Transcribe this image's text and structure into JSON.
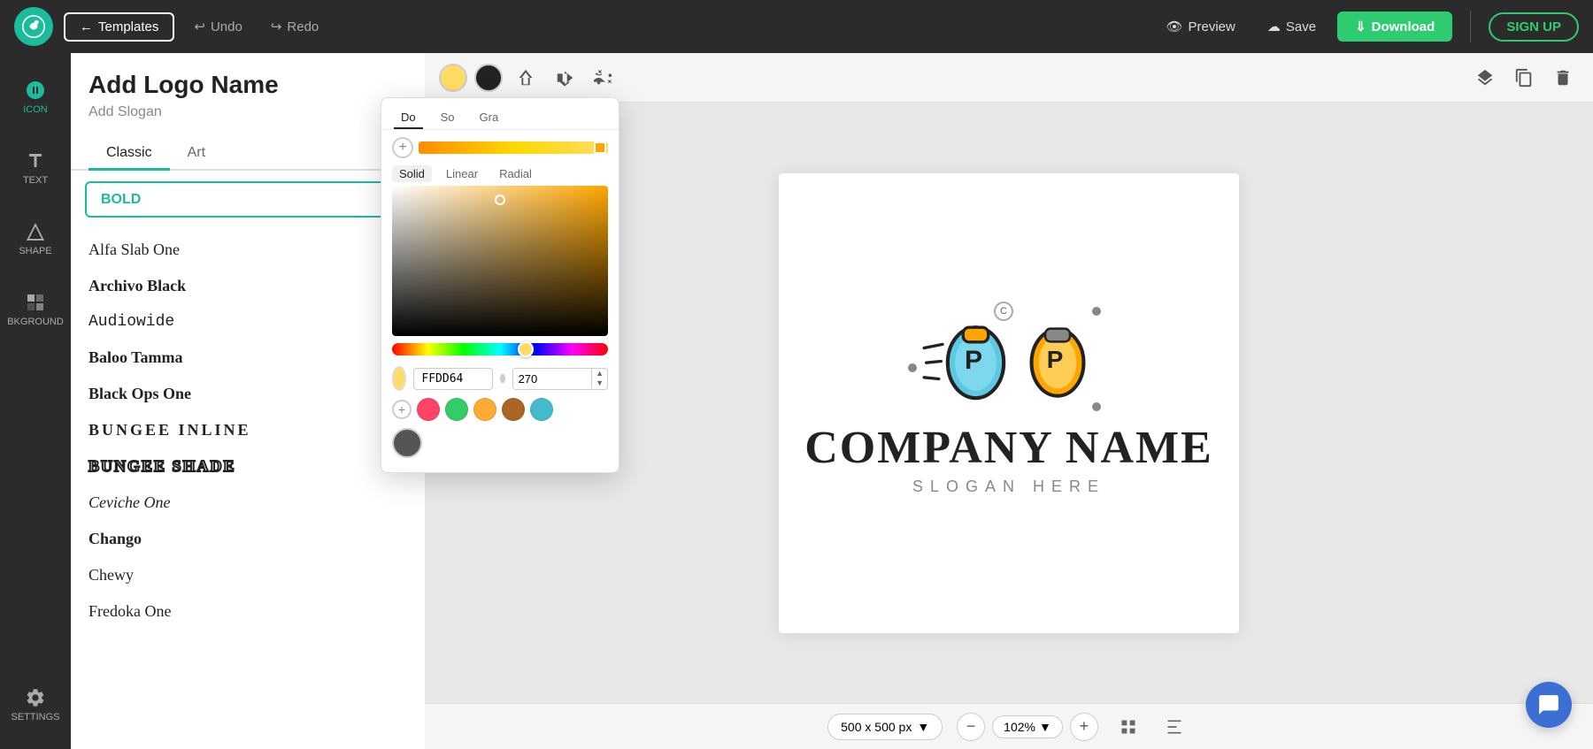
{
  "nav": {
    "templates_label": "Templates",
    "undo_label": "Undo",
    "redo_label": "Redo",
    "preview_label": "Preview",
    "save_label": "Save",
    "download_label": "Download",
    "signup_label": "SIGN UP"
  },
  "sidebar": {
    "items": [
      {
        "id": "icon",
        "label": "ICON"
      },
      {
        "id": "text",
        "label": "TEXT"
      },
      {
        "id": "shape",
        "label": "SHAPE"
      },
      {
        "id": "background",
        "label": "BKGROUND"
      },
      {
        "id": "settings",
        "label": "SETTINGS"
      }
    ]
  },
  "font_panel": {
    "title": "Add Logo Name",
    "slogan": "Add Slogan",
    "tabs": [
      "Classic",
      "Art"
    ],
    "active_tab": "Classic",
    "style_label": "BOLD",
    "fonts": [
      {
        "name": "Alfa Slab One",
        "style": "normal"
      },
      {
        "name": "Archivo Black",
        "style": "normal"
      },
      {
        "name": "Audiowide",
        "style": "normal"
      },
      {
        "name": "Baloo Tamma",
        "style": "normal"
      },
      {
        "name": "Black Ops One",
        "style": "normal"
      },
      {
        "name": "BUNGEE INLINE",
        "style": "bungee-inline bold"
      },
      {
        "name": "BUNGEE SHADE",
        "style": "bungee-shade bold"
      },
      {
        "name": "Ceviche One",
        "style": "ceviche"
      },
      {
        "name": "Chango",
        "style": "bold"
      },
      {
        "name": "Chewy",
        "style": "normal"
      },
      {
        "name": "Fredoka One",
        "style": "normal"
      }
    ]
  },
  "color_picker": {
    "tabs": [
      "Do",
      "So",
      "Gra"
    ],
    "hex_value": "FFDD64",
    "opacity_value": "270",
    "recent_colors": [
      {
        "color": "#ff4466"
      },
      {
        "color": "#33cc66"
      },
      {
        "color": "#ffaa33"
      },
      {
        "color": "#aa6622"
      },
      {
        "color": "#44bbcc"
      }
    ],
    "dark_swatch": "#555555"
  },
  "toolbar": {
    "color1": "#FFDD64",
    "color2": "#222222"
  },
  "canvas": {
    "company_name": "COMPANY NAME",
    "slogan": "SLOGAN HERE",
    "size": "500 x 500 px",
    "zoom": "102%"
  },
  "bottom_bar": {
    "size_label": "500 x 500 px",
    "zoom_label": "102%"
  }
}
